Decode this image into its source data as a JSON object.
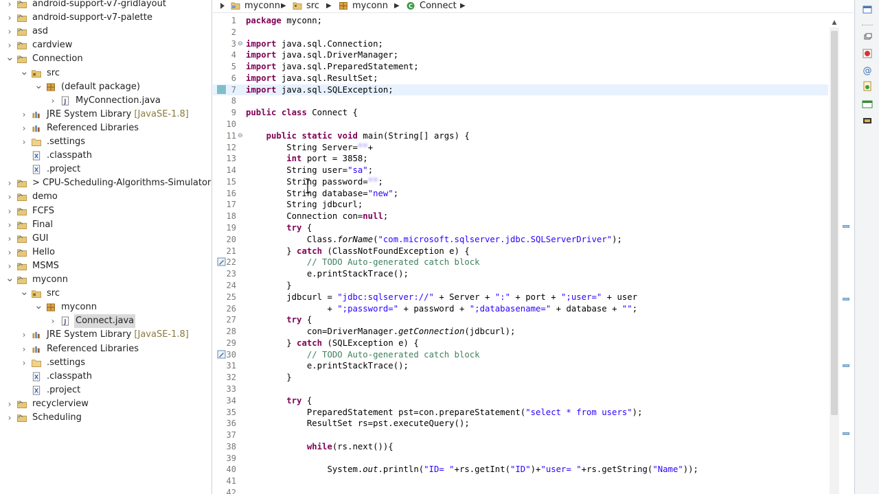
{
  "explorer": {
    "items": [
      {
        "label": "android-support-v7-gridlayout",
        "deco": ""
      },
      {
        "label": "android-support-v7-palette",
        "deco": ""
      },
      {
        "label": "asd",
        "deco": ""
      },
      {
        "label": "cardview",
        "deco": ""
      },
      {
        "label": "Connection",
        "deco": ""
      },
      {
        "label": "src",
        "deco": ""
      },
      {
        "label": "(default package)",
        "deco": ""
      },
      {
        "label": "MyConnection.java",
        "deco": ""
      },
      {
        "label": "JRE System Library",
        "deco": "[JavaSE-1.8]"
      },
      {
        "label": "Referenced Libraries",
        "deco": ""
      },
      {
        "label": ".settings",
        "deco": ""
      },
      {
        "label": ".classpath",
        "deco": ""
      },
      {
        "label": ".project",
        "deco": ""
      },
      {
        "label": "> CPU-Scheduling-Algorithms-Simulator",
        "deco": ""
      },
      {
        "label": "demo",
        "deco": ""
      },
      {
        "label": "FCFS",
        "deco": ""
      },
      {
        "label": "Final",
        "deco": ""
      },
      {
        "label": "GUI",
        "deco": ""
      },
      {
        "label": "Hello",
        "deco": ""
      },
      {
        "label": "MSMS",
        "deco": ""
      },
      {
        "label": "myconn",
        "deco": ""
      },
      {
        "label": "src",
        "deco": ""
      },
      {
        "label": "myconn",
        "deco": ""
      },
      {
        "label": "Connect.java",
        "deco": ""
      },
      {
        "label": "JRE System Library",
        "deco": "[JavaSE-1.8]"
      },
      {
        "label": "Referenced Libraries",
        "deco": ""
      },
      {
        "label": ".settings",
        "deco": ""
      },
      {
        "label": ".classpath",
        "deco": ""
      },
      {
        "label": ".project",
        "deco": ""
      },
      {
        "label": "recyclerview",
        "deco": ""
      },
      {
        "label": "Scheduling",
        "deco": ""
      }
    ]
  },
  "breadcrumb": {
    "items": [
      "myconn",
      "src",
      "myconn",
      "Connect"
    ]
  },
  "editor": {
    "lines": [
      {
        "n": "1",
        "code": "package myconn;"
      },
      {
        "n": "2",
        "code": ""
      },
      {
        "n": "3",
        "code": "import java.sql.Connection;"
      },
      {
        "n": "4",
        "code": "import java.sql.DriverManager;"
      },
      {
        "n": "5",
        "code": "import java.sql.PreparedStatement;"
      },
      {
        "n": "6",
        "code": "import java.sql.ResultSet;"
      },
      {
        "n": "7",
        "code": "import java.sql.SQLException;"
      },
      {
        "n": "8",
        "code": ""
      },
      {
        "n": "9",
        "code": "public class Connect {"
      },
      {
        "n": "10",
        "code": ""
      },
      {
        "n": "11",
        "code": "    public static void main(String[] args) {"
      },
      {
        "n": "12",
        "code": "        String Server=\"\"+"
      },
      {
        "n": "13",
        "code": "        int port = 3858;"
      },
      {
        "n": "14",
        "code": "        String user=\"sa\";"
      },
      {
        "n": "15",
        "code": "        String password=\"\";"
      },
      {
        "n": "16",
        "code": "        String database=\"new\";"
      },
      {
        "n": "17",
        "code": "        String jdbcurl;"
      },
      {
        "n": "18",
        "code": "        Connection con=null;"
      },
      {
        "n": "19",
        "code": "        try {"
      },
      {
        "n": "20",
        "code": "            Class.forName(\"com.microsoft.sqlserver.jdbc.SQLServerDriver\");"
      },
      {
        "n": "21",
        "code": "        } catch (ClassNotFoundException e) {"
      },
      {
        "n": "22",
        "code": "            // TODO Auto-generated catch block"
      },
      {
        "n": "23",
        "code": "            e.printStackTrace();"
      },
      {
        "n": "24",
        "code": "        }"
      },
      {
        "n": "25",
        "code": "        jdbcurl = \"jdbc:sqlserver://\" + Server + \":\" + port + \";user=\" + user"
      },
      {
        "n": "26",
        "code": "                + \";password=\" + password + \";databasename=\" + database + \"\";"
      },
      {
        "n": "27",
        "code": "        try {"
      },
      {
        "n": "28",
        "code": "            con=DriverManager.getConnection(jdbcurl);"
      },
      {
        "n": "29",
        "code": "        } catch (SQLException e) {"
      },
      {
        "n": "30",
        "code": "            // TODO Auto-generated catch block"
      },
      {
        "n": "31",
        "code": "            e.printStackTrace();"
      },
      {
        "n": "32",
        "code": "        }"
      },
      {
        "n": "33",
        "code": ""
      },
      {
        "n": "34",
        "code": "        try {"
      },
      {
        "n": "35",
        "code": "            PreparedStatement pst=con.prepareStatement(\"select * from users\");"
      },
      {
        "n": "36",
        "code": "            ResultSet rs=pst.executeQuery();"
      },
      {
        "n": "37",
        "code": ""
      },
      {
        "n": "38",
        "code": "            while(rs.next()){"
      },
      {
        "n": "39",
        "code": ""
      },
      {
        "n": "40",
        "code": "                System.out.println(\"ID= \"+rs.getInt(\"ID\")+\"user= \"+rs.getString(\"Name\"));"
      },
      {
        "n": "41",
        "code": ""
      },
      {
        "n": "42",
        "code": ""
      }
    ]
  },
  "colors": {
    "keyword": "#7f0055",
    "string": "#2a00ff",
    "comment": "#3f7f5f",
    "current_line": "#e8f2fe",
    "selection": "#d9d9d9"
  },
  "toolbar_icons": [
    "restore-icon",
    "minimize-icon",
    "maximize-icon",
    "problems-icon",
    "javadoc-icon",
    "declaration-icon",
    "console-icon",
    "progress-icon"
  ]
}
